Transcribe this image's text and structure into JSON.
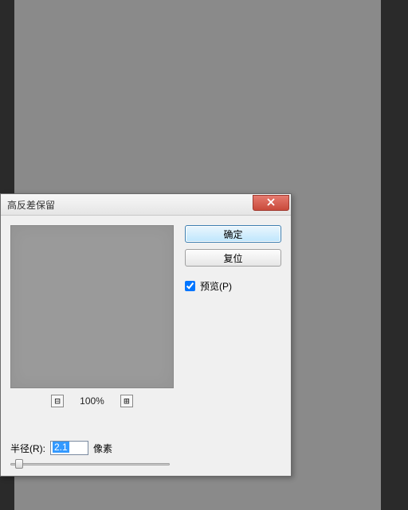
{
  "dialog": {
    "title": "高反差保留",
    "ok_label": "确定",
    "reset_label": "复位",
    "preview_label": "预览(P)",
    "preview_checked": true,
    "zoom": {
      "minus": "⊟",
      "plus": "⊞",
      "value": "100%"
    },
    "radius_label": "半径(R):",
    "radius_value": "2.1",
    "radius_unit": "像素"
  }
}
